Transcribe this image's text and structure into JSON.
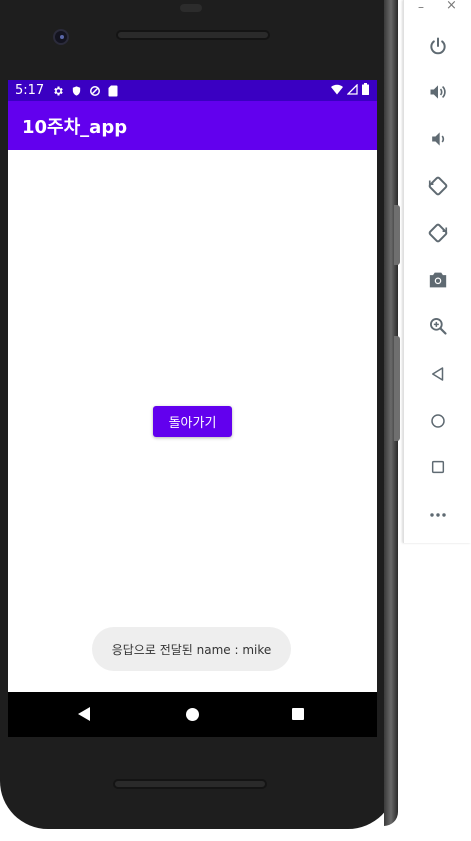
{
  "status_bar": {
    "time": "5:17"
  },
  "app_bar": {
    "title": "10주차_app"
  },
  "main": {
    "back_button_label": "돌아가기"
  },
  "toast": {
    "message": "응답으로 전달된 name : mike"
  },
  "emulator_panel": {
    "window_controls": {
      "minimize": "–",
      "close": "×"
    },
    "buttons": [
      "power-icon",
      "volume-up-icon",
      "volume-down-icon",
      "rotate-left-icon",
      "rotate-right-icon",
      "screenshot-icon",
      "zoom-icon",
      "back-icon",
      "home-icon",
      "overview-icon",
      "more-icon"
    ]
  },
  "colors": {
    "primary": "#6200ee",
    "primary_dark": "#3a00c2",
    "toast_bg": "#eeeeee",
    "panel_icon": "#5f6a72"
  }
}
